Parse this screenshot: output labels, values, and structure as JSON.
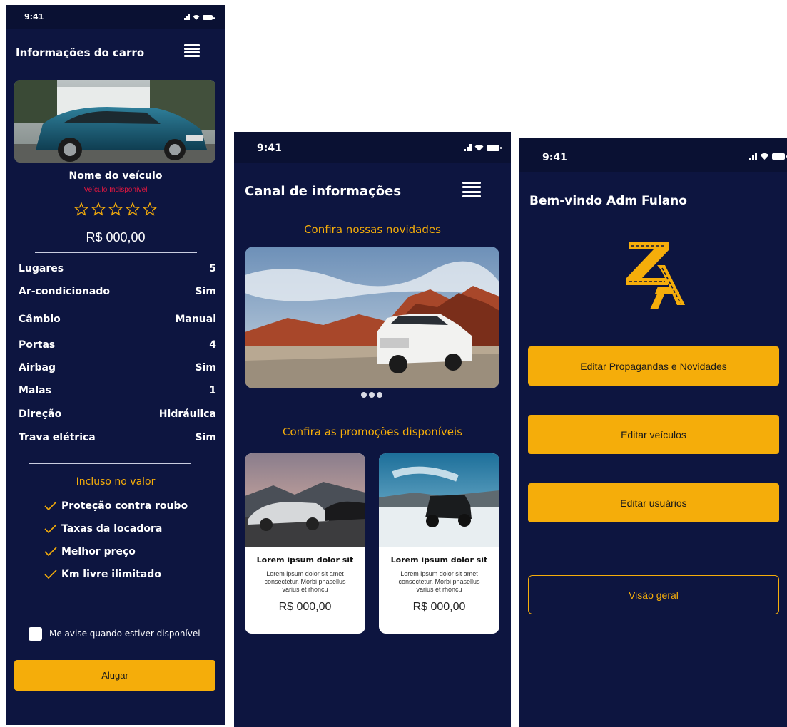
{
  "screen1": {
    "status_time": "9:41",
    "title": "Informações do carro",
    "vehicle_name": "Nome do veículo",
    "availability": "Veículo Indisponível",
    "rating": 0,
    "rating_max": 5,
    "price": "R$ 000,00",
    "specs": [
      {
        "label": "Lugares",
        "value": "5"
      },
      {
        "label": "Ar-condicionado",
        "value": "Sim"
      },
      {
        "label": "Câmbio",
        "value": "Manual"
      },
      {
        "label": "Portas",
        "value": "4"
      },
      {
        "label": "Airbag",
        "value": "Sim"
      },
      {
        "label": "Malas",
        "value": "1"
      },
      {
        "label": "Direção",
        "value": "Hidráulica"
      },
      {
        "label": "Trava elétrica",
        "value": "Sim"
      }
    ],
    "included_title": "Incluso no valor",
    "included": [
      "Proteção contra roubo",
      "Taxas da locadora",
      "Melhor preço",
      "Km livre ilimitado"
    ],
    "notify_label": "Me avise quando estiver disponível",
    "rent_button": "Alugar"
  },
  "screen2": {
    "status_time": "9:41",
    "title": "Canal de informações",
    "news_heading": "Confira nossas novidades",
    "promo_heading": "Confira as promoções disponíveis",
    "cards": [
      {
        "title": "Lorem ipsum dolor sit",
        "desc": "Lorem ipsum dolor sit amet consectetur. Morbi phasellus varius et rhoncu",
        "price": "R$ 000,00"
      },
      {
        "title": "Lorem ipsum dolor sit",
        "desc": "Lorem ipsum dolor sit amet consectetur. Morbi phasellus varius et rhoncu",
        "price": "R$ 000,00"
      }
    ]
  },
  "screen3": {
    "status_time": "9:41",
    "title": "Bem-vindo Adm Fulano",
    "btn_ads": "Editar Propagandas e Novidades",
    "btn_vehicles": "Editar veículos",
    "btn_users": "Editar usuários",
    "btn_overview": "Visão geral"
  },
  "colors": {
    "background": "#0d1540",
    "accent": "#f5ad0a",
    "unavailable": "#e5173f"
  },
  "icons": [
    "hamburger-menu-icon",
    "star-outline-icon",
    "check-icon",
    "signal-icon",
    "wifi-icon",
    "battery-icon"
  ]
}
